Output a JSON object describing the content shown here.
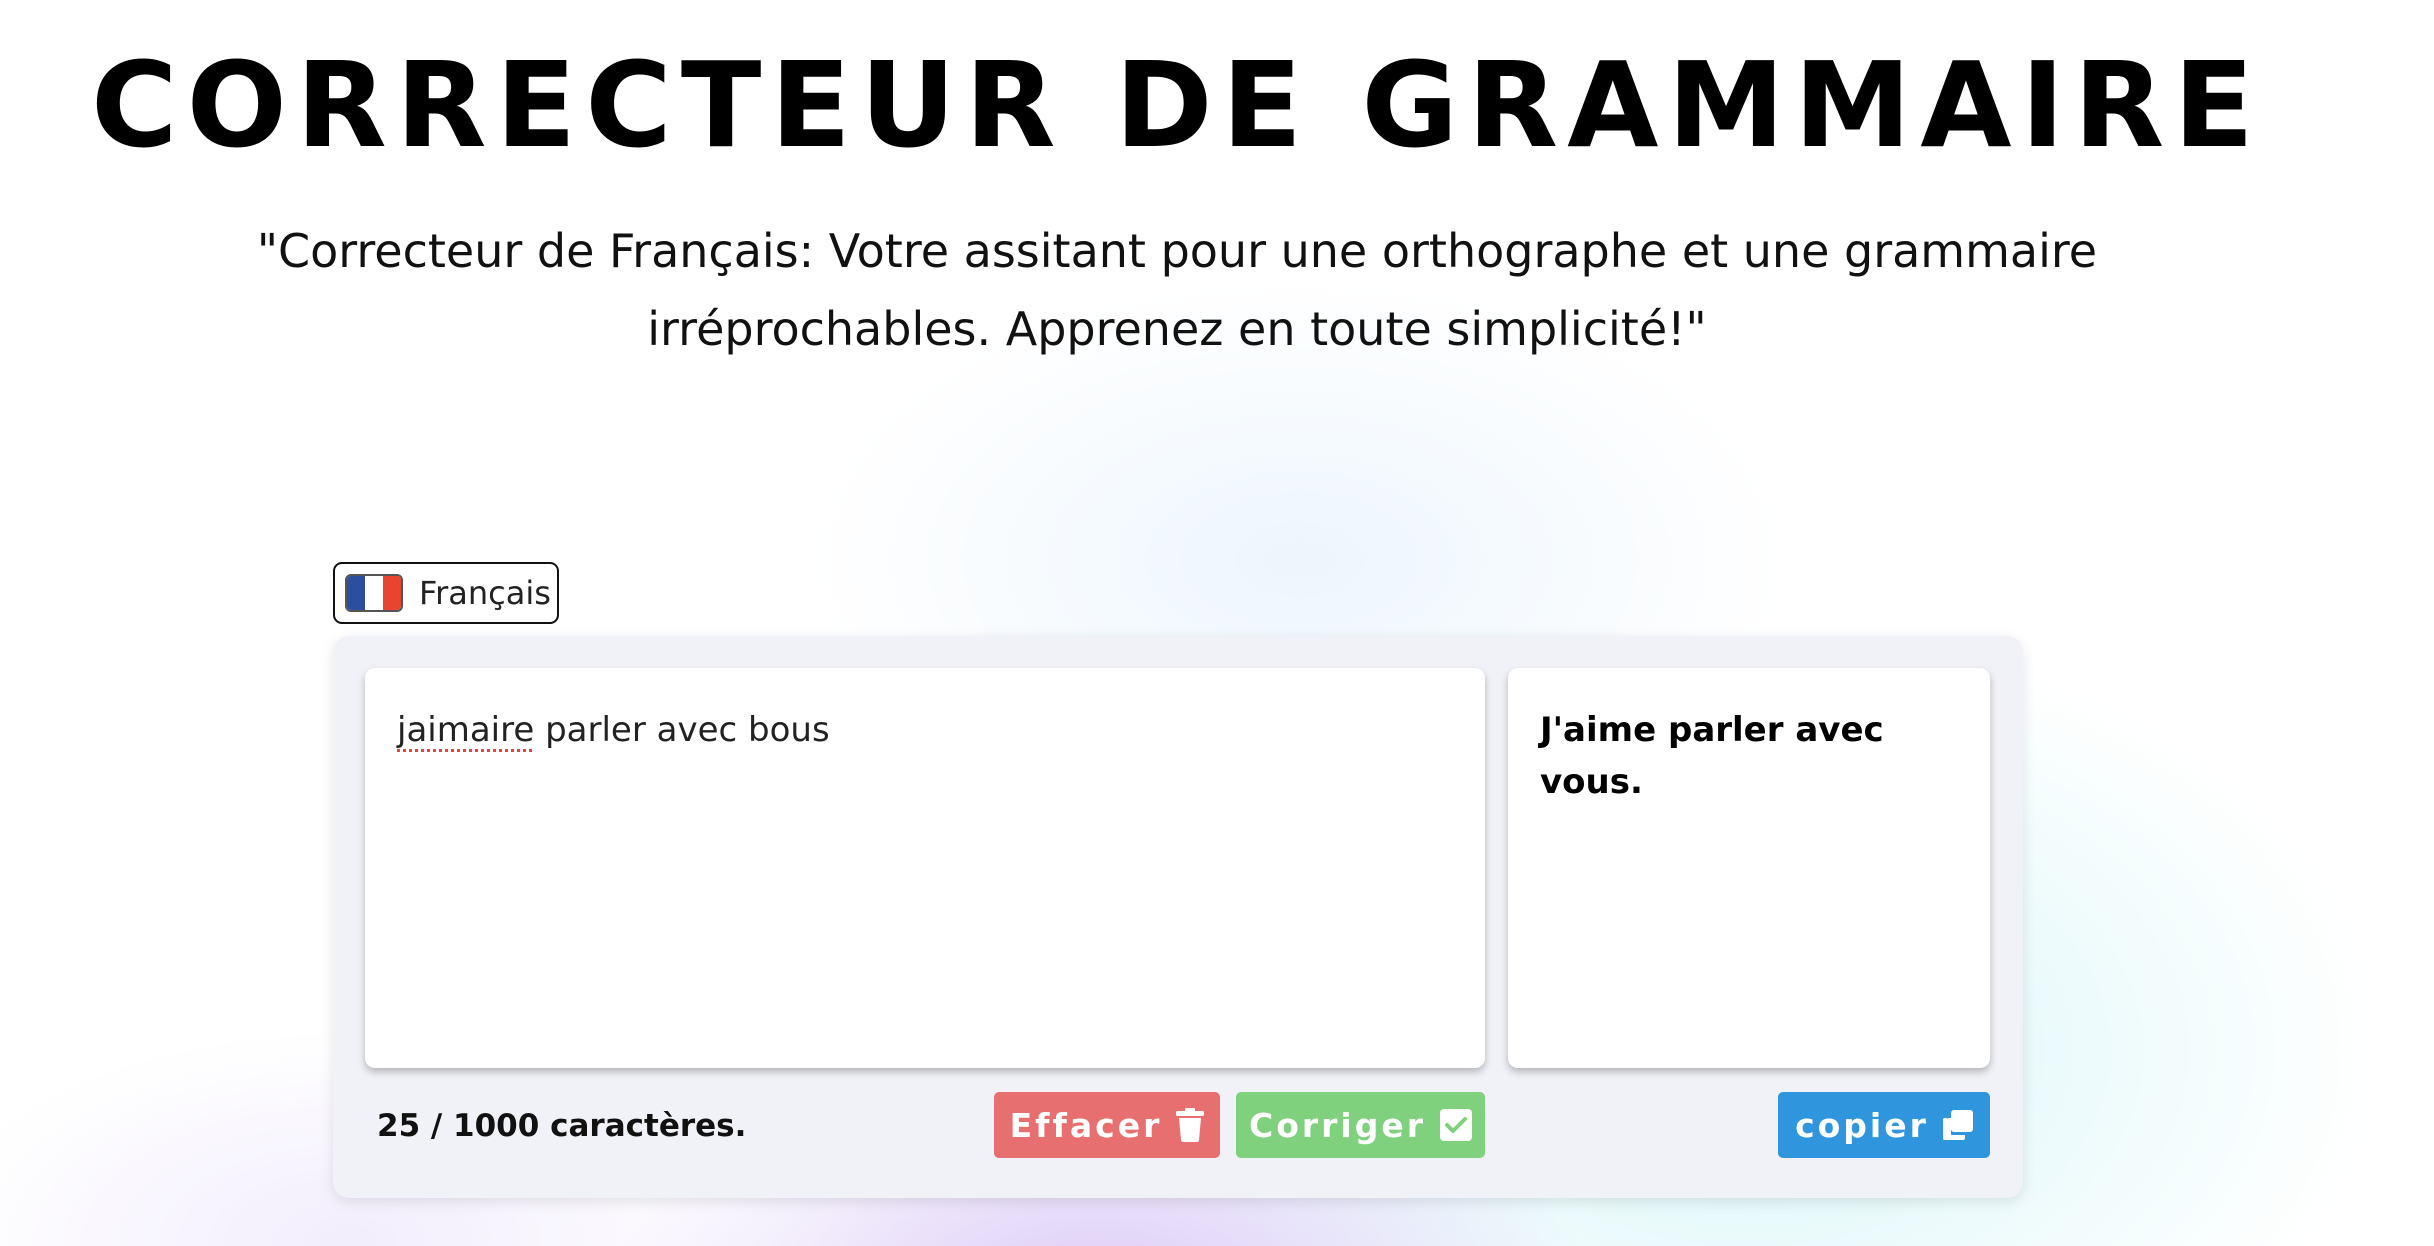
{
  "header": {
    "title": "CORRECTEUR DE GRAMMAIRE",
    "subtitle_line1": "\"Correcteur de Français: Votre assitant pour une orthographe et une grammaire",
    "subtitle_line2": "irréprochables. Apprenez en toute simplicité!\""
  },
  "language": {
    "label": "Français",
    "flag_colors": [
      "#2b4ea0",
      "#ffffff",
      "#e8442f"
    ]
  },
  "editor": {
    "input_misspelled_word": "jaimaire",
    "input_rest": " parler avec bous",
    "char_count": "25 / 1000 caractères."
  },
  "result": {
    "text": "J'aime parler avec vous."
  },
  "buttons": {
    "clear_label": "Effacer",
    "correct_label": "Corriger",
    "copy_label": "copier"
  },
  "colors": {
    "clear": "#e76f6f",
    "correct": "#7fd17d",
    "copy": "#2f96de"
  },
  "icons": {
    "clear": "trash-icon",
    "correct": "check-square-icon",
    "copy": "copy-icon"
  }
}
